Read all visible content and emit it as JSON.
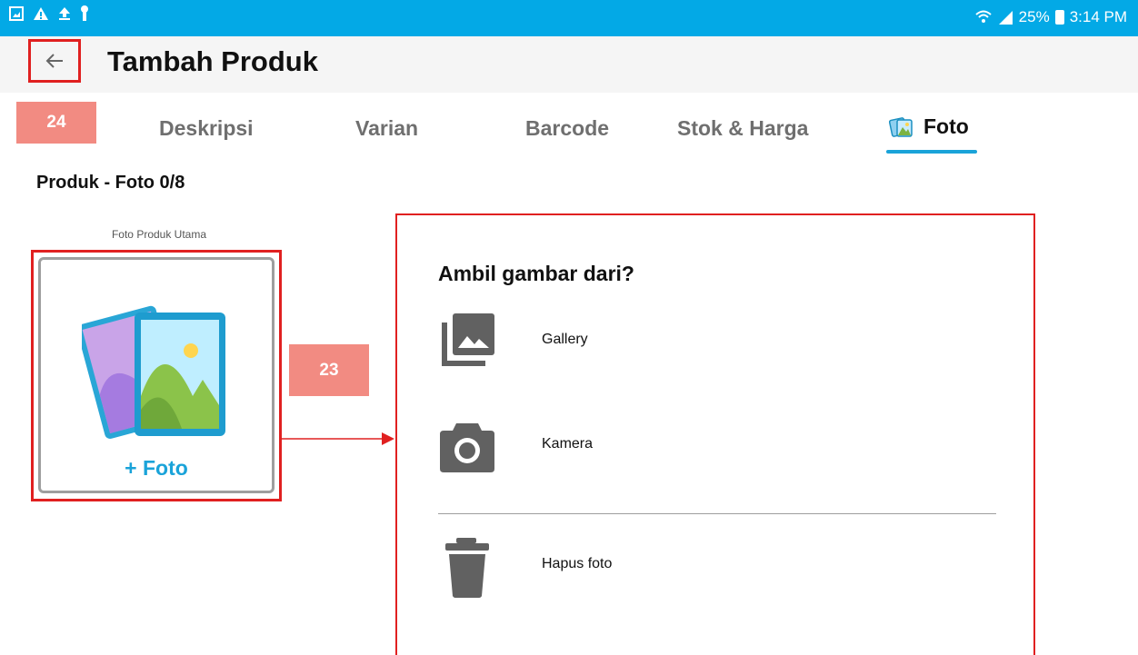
{
  "status_bar": {
    "icons_left": [
      "image-icon",
      "warning-icon",
      "upload-icon",
      "key-icon"
    ],
    "battery": "25%",
    "time": "3:14 PM"
  },
  "app_bar": {
    "title": "Tambah Produk",
    "back_icon": "arrow-left-icon"
  },
  "annotations": {
    "badge_top": "24",
    "badge_middle": "23"
  },
  "tabs": [
    {
      "label": "Deskripsi",
      "active": false
    },
    {
      "label": "Varian",
      "active": false
    },
    {
      "label": "Barcode",
      "active": false
    },
    {
      "label": "Stok & Harga",
      "active": false
    },
    {
      "label": "Foto",
      "active": true,
      "icon": "photo-icon"
    }
  ],
  "section": {
    "title": "Produk - Foto 0/8",
    "main_photo_caption": "Foto Produk Utama",
    "add_photo_label": "Foto"
  },
  "dialog": {
    "title": "Ambil gambar dari?",
    "options": [
      {
        "label": "Gallery",
        "icon": "gallery-icon"
      },
      {
        "label": "Kamera",
        "icon": "camera-icon"
      },
      {
        "label": "Hapus foto",
        "icon": "trash-icon"
      }
    ]
  },
  "colors": {
    "status_bar": "#03a9e6",
    "accent": "#1aa3d9",
    "highlight": "#e02020",
    "badge": "#f28b82"
  }
}
